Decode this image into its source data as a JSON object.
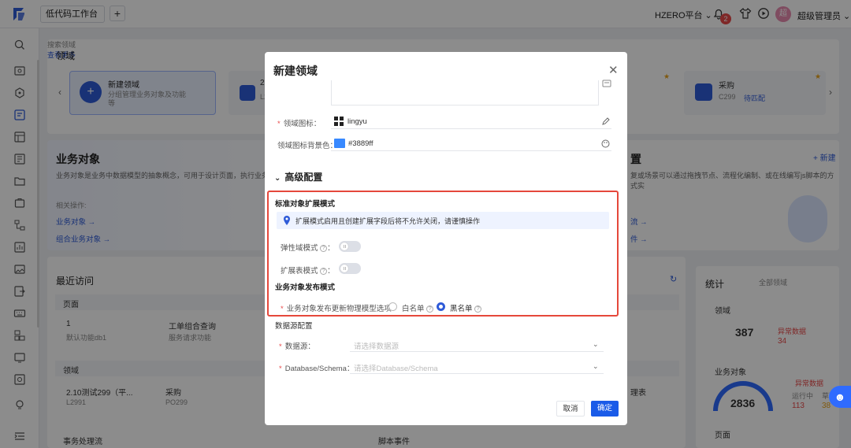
{
  "topbar": {
    "tab_label": "低代码工作台",
    "add_tab": "+",
    "platform": "HZERO平台 ⌄",
    "notifications_count": "2",
    "avatar_text": "超",
    "username": "超级管理员 ⌄"
  },
  "background": {
    "domain_title": "领域",
    "domain_search": "搜索领域",
    "view_more": "查看更多",
    "new_domain_title": "新建领域",
    "new_domain_desc": "分组管理业务对象及功能",
    "new_domain_desc2": "等",
    "domain_item_code_partial": "2.",
    "domain_item_code_partial2": "L2",
    "domain_card_purchase": "采购",
    "domain_card_purchase_code": "C299",
    "domain_card_purchase_tag": "待匹配",
    "business_object_title": "业务对象",
    "business_object_desc": "业务对象是业务中数据模型的抽象概念，可用于设计页面，执行业务逻",
    "related_ops": "相关操作:",
    "link_business_object": "业务对象 →",
    "link_composite_object": "组合业务对象 →",
    "right_section_partial": "置",
    "right_new": "+ 新建",
    "right_desc": "复或场景可以通过拖拽节点、流程化编制、或在线编写js脚本的方式实",
    "right_link1": "流 →",
    "right_link2": "件 →",
    "recent_title": "最近访问",
    "recent_page": "页面",
    "recent_item1_title": "1",
    "recent_item1_sub": "默认功能db1",
    "recent_item2_title": "工单组合查询",
    "recent_item2_sub": "服务请求功能",
    "recent_domain": "领域",
    "recent_domain1_title": "2.10测试299（平...",
    "recent_domain1_code": "L2991",
    "recent_domain2_title": "采购",
    "recent_domain2_code": "PO299",
    "recent_right_partial": "理表",
    "flow_title": "事务处理流",
    "script_title": "脚本事件",
    "stats_title": "统计",
    "stats_filter": "全部领域",
    "stats_domain": "领域",
    "stats_domain_count": "387",
    "stats_abnormal": "异常数据",
    "stats_abnormal_count": "34",
    "stats_bo": "业务对象",
    "stats_bo_count": "2836",
    "stats_bo_abnormal": "异常数据",
    "stats_bo_abnormal_count": "113",
    "stats_running": "运行中",
    "stats_draft": "草稿",
    "stats_draft_count": "38",
    "stats_page": "页面"
  },
  "modal": {
    "title": "新建领域",
    "domain_icon_label": "领域图标",
    "domain_icon_value": "lingyu",
    "domain_icon_bg_label": "领域图标背景色",
    "domain_icon_bg_value": "#3889ff",
    "advanced_config": "高级配置",
    "std_ext_mode": "标准对象扩展模式",
    "info_text": "扩展模式启用且创建扩展字段后将不允许关闭，请谨慎操作",
    "elastic_mode_label": "弹性域模式",
    "ext_table_mode_label": "扩展表模式",
    "bo_publish_mode": "业务对象发布模式",
    "bo_publish_label": "业务对象发布更新物理模型选项",
    "whitelist": "白名单",
    "blacklist": "黑名单",
    "datasource_config": "数据源配置",
    "datasource_label": "数据源",
    "datasource_placeholder": "请选择数据源",
    "schema_label": "Database/Schema",
    "schema_placeholder": "请选择Database/Schema",
    "cancel": "取消",
    "confirm": "确定"
  },
  "colors": {
    "accent": "#2f5bd8",
    "primary_button": "#1a5be8",
    "highlight_border": "#e5483b",
    "icon_bg": "#3889ff",
    "required": "#e84a4a"
  }
}
